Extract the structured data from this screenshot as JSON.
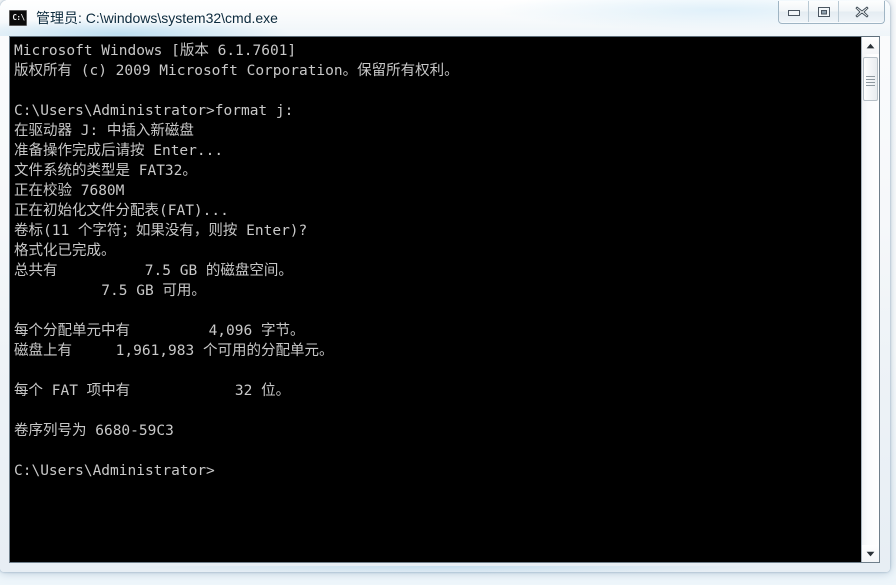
{
  "window": {
    "title": "管理员: C:\\windows\\system32\\cmd.exe",
    "icon_name": "cmd-console-icon",
    "icon_glyph": "C:\\",
    "minimize_label": "最小化",
    "maximize_label": "最大化",
    "close_label": "关闭"
  },
  "console": {
    "background_color": "#000000",
    "text_color": "#c8c8c8",
    "lines": [
      "Microsoft Windows [版本 6.1.7601]",
      "版权所有 (c) 2009 Microsoft Corporation。保留所有权利。",
      "",
      "C:\\Users\\Administrator>format j:",
      "在驱动器 J: 中插入新磁盘",
      "准备操作完成后请按 Enter...",
      "文件系统的类型是 FAT32。",
      "正在校验 7680M",
      "正在初始化文件分配表(FAT)...",
      "卷标(11 个字符；如果没有，则按 Enter)?",
      "格式化已完成。",
      "总共有          7.5 GB 的磁盘空间。",
      "          7.5 GB 可用。",
      "",
      "每个分配单元中有         4,096 字节。",
      "磁盘上有     1,961,983 个可用的分配单元。",
      "",
      "每个 FAT 项中有            32 位。",
      "",
      "卷序列号为 6680-59C3",
      "",
      "C:\\Users\\Administrator>"
    ]
  },
  "scrollbar": {
    "up_arrow_name": "scroll-up-arrow",
    "down_arrow_name": "scroll-down-arrow",
    "thumb_name": "scrollbar-thumb"
  }
}
